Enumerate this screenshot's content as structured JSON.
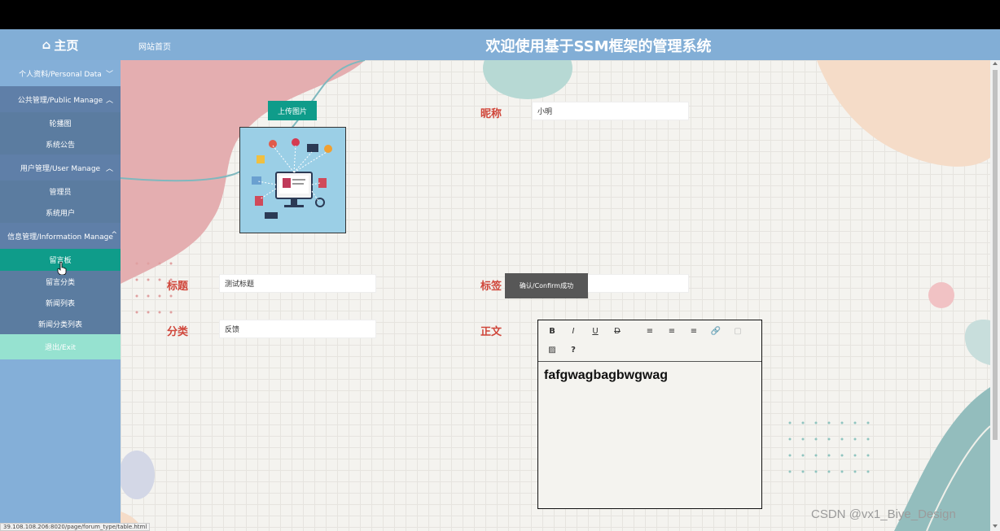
{
  "header": {
    "home_label": "主页",
    "site_link": "网站首页",
    "title": "欢迎使用基于SSM框架的管理系统"
  },
  "sidebar": {
    "personal": "个人资料/Personal Data",
    "public_manage": "公共管理/Public Manage",
    "public_items": [
      "轮播图",
      "系统公告"
    ],
    "user_manage": "用户管理/User Manage",
    "user_items": [
      "管理员",
      "系统用户"
    ],
    "info_manage": "信息管理/Information Manage",
    "info_items": [
      "留言板",
      "留言分类",
      "新闻列表",
      "新闻分类列表"
    ],
    "exit": "退出/Exit"
  },
  "form": {
    "upload_button": "上传图片",
    "nickname_label": "昵称",
    "nickname_value": "小明",
    "title_label": "标题",
    "title_value": "测试标题",
    "tag_label": "标签",
    "category_label": "分类",
    "category_value": "反馈",
    "content_label": "正文",
    "content_value": "fafgwagbagbwgwag"
  },
  "editor_toolbar": {
    "bold": "B",
    "italic": "I",
    "underline": "U",
    "strike": "D",
    "help": "?"
  },
  "toast": "确认/Confirm成功",
  "status_url": "39.108.108.206:8020/page/forum_type/table.html",
  "watermark": "CSDN @vx1_Biye_Design",
  "colors": {
    "header_bg": "#82aed6",
    "sidebar_bg": "#84afd8",
    "submenu_bg": "#5b7ca0",
    "active_item": "#0f9c8a",
    "exit_bg": "#96e2d0",
    "label_color": "#d0463a"
  }
}
